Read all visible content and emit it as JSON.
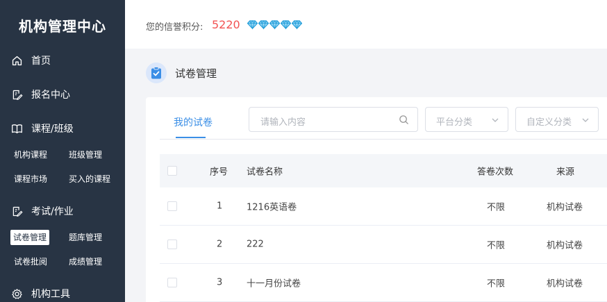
{
  "app": {
    "title": "机构管理中心"
  },
  "sidebar": {
    "items": [
      {
        "label": "首页",
        "icon": "home-icon"
      },
      {
        "label": "报名中心",
        "icon": "edit-icon"
      },
      {
        "label": "课程/班级",
        "icon": "book-icon"
      },
      {
        "label": "考试/作业",
        "icon": "edit-icon"
      },
      {
        "label": "机构工具",
        "icon": "gear-icon"
      }
    ],
    "sub": {
      "courses": [
        "机构课程",
        "班级管理",
        "课程市场",
        "买入的课程"
      ],
      "exams": [
        "试卷管理",
        "题库管理",
        "试卷批阅",
        "成绩管理"
      ]
    },
    "active": "试卷管理"
  },
  "topbar": {
    "credit_label": "您的信誉积分:",
    "credit_value": "5220",
    "diamond_count": 5,
    "diamond_icon": "diamond-icon",
    "diamond_color": "#1e9bd7",
    "credit_color": "#f25353"
  },
  "page": {
    "title": "试卷管理",
    "icon": "clipboard-check-icon"
  },
  "tabs": [
    {
      "label": "我的试卷",
      "active": true
    }
  ],
  "filters": {
    "search_placeholder": "请输入内容",
    "platform_category": "平台分类",
    "custom_category": "自定义分类"
  },
  "table": {
    "headers": {
      "index": "序号",
      "name": "试卷名称",
      "attempts": "答卷次数",
      "source": "来源"
    },
    "rows": [
      {
        "index": "1",
        "name": "1216英语卷",
        "attempts": "不限",
        "source": "机构试卷"
      },
      {
        "index": "2",
        "name": "222",
        "attempts": "不限",
        "source": "机构试卷"
      },
      {
        "index": "3",
        "name": "十一月份试卷",
        "attempts": "不限",
        "source": "机构试卷"
      }
    ]
  },
  "colors": {
    "accent": "#3a8ee6",
    "sidebar_bg": "#283444"
  }
}
